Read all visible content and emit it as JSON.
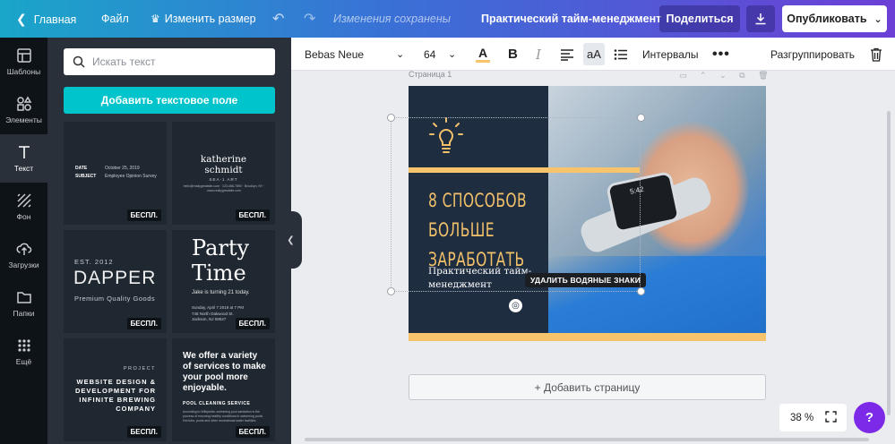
{
  "topbar": {
    "home_label": "Главная",
    "file_label": "Файл",
    "resize_label": "Изменить размер",
    "saved_status": "Изменения сохранены",
    "doc_title": "Практический тайм-менеджмент",
    "share_label": "Поделиться",
    "publish_label": "Опубликовать",
    "gradient_colors": [
      "#1aa6c9",
      "#3b6fd6",
      "#6c3fd6"
    ]
  },
  "rail": {
    "items": [
      {
        "label": "Шаблоны",
        "icon": "layout-icon"
      },
      {
        "label": "Элементы",
        "icon": "shapes-icon"
      },
      {
        "label": "Текст",
        "icon": "text-icon",
        "active": true
      },
      {
        "label": "Фон",
        "icon": "background-icon"
      },
      {
        "label": "Загрузки",
        "icon": "upload-icon"
      },
      {
        "label": "Папки",
        "icon": "folder-icon"
      },
      {
        "label": "Ещё",
        "icon": "more-grid-icon"
      }
    ]
  },
  "panel": {
    "search_placeholder": "Искать текст",
    "add_text_button": "Добавить текстовое поле",
    "accent_color": "#00c4cc",
    "free_badge": "БЕСПЛ.",
    "tiles": {
      "t1": {
        "date_label": "DATE",
        "date_value": "October 25, 2019",
        "subject_label": "SUBJECT",
        "subject_value": "Employee Opinion Survey"
      },
      "t2": {
        "name": "katherine\nschmidt",
        "role": "SEA-1 ART",
        "contact": "hello@reallygreatsite.com · 123-456-7890 · Brooklyn, NY · www.reallygreatsite.com"
      },
      "t3": {
        "est": "EST. 2012",
        "title": "DAPPER",
        "tagline": "Premium Quality Goods"
      },
      "t4": {
        "title": "Party\nTime",
        "subtitle": "Jake is turning 21 today.",
        "details": "Sunday, April 7 2019 at 7 PM\n748 North Oakwood St.\nJackson, NJ 08527"
      },
      "t5": {
        "label": "PROJECT",
        "title": "WEBSITE DESIGN &\nDEVELOPMENT FOR\nINFINITE BREWING\nCOMPANY"
      },
      "t6": {
        "title": "We offer a variety\nof services to make\nyour pool more\nenjoyable.",
        "service": "POOL CLEANING SERVICE",
        "body": "According to Wikipedia, swimming pool sanitation is the process of ensuring healthy conditions in swimming pools. Hot tubs, pools and other recreational water facilities."
      }
    }
  },
  "format_bar": {
    "font_family": "Bebas Neue",
    "font_size": "64",
    "spacing_label": "Интервалы",
    "ungroup_label": "Разгруппировать",
    "text_color": "#f7c46c"
  },
  "canvas": {
    "page_label": "Страница 1",
    "design": {
      "headline": "8 СПОСОБОВ\nБОЛЬШЕ\nЗАРАБОТАТЬ",
      "subtitle": "Практический тайм-\nменеджмент",
      "watermark_notice": "УДАЛИТЬ ВОДЯНЫЕ ЗНАКИ",
      "bg_color": "#1f2d40",
      "accent_color": "#f7c46c",
      "watch_time": "5:42"
    },
    "add_page_label": "+ Добавить страницу"
  },
  "zoom": {
    "level": "38 %"
  },
  "help": {
    "label": "?",
    "color": "#7d2ae8"
  }
}
